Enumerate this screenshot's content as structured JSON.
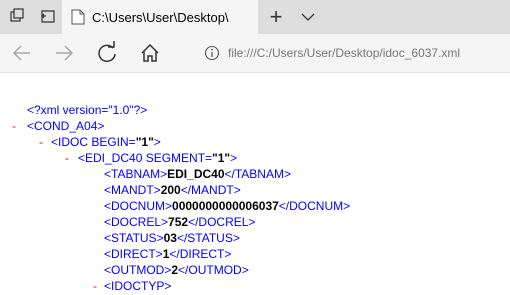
{
  "tab": {
    "title": "C:\\Users\\User\\Desktop\\",
    "new_tab_symbol": "+"
  },
  "address": {
    "url": "file:///C:/Users/User/Desktop/idoc_6037.xml"
  },
  "icons": [
    "tab-preview-icon",
    "tab-aside-icon",
    "page-icon",
    "chevron-down-icon",
    "back-icon",
    "forward-icon",
    "refresh-icon",
    "home-icon",
    "info-icon"
  ],
  "xml": {
    "decl": "<?xml version=\"1.0\"?>",
    "minus": "-",
    "cond_open": "<COND_A04>",
    "idoc_tag": "<IDOC BEGIN=",
    "idoc_val": "\"1\"",
    "idoc_end": ">",
    "edi_tag": "<EDI_DC40 SEGMENT=",
    "edi_val": "\"1\"",
    "edi_end": ">",
    "fields": [
      {
        "open": "<TABNAM>",
        "value": "EDI_DC40",
        "close": "</TABNAM>"
      },
      {
        "open": "<MANDT>",
        "value": "200",
        "close": "</MANDT>"
      },
      {
        "open": "<DOCNUM>",
        "value": "0000000000006037",
        "close": "</DOCNUM>"
      },
      {
        "open": "<DOCREL>",
        "value": "752",
        "close": "</DOCREL>"
      },
      {
        "open": "<STATUS>",
        "value": "03",
        "close": "</STATUS>"
      },
      {
        "open": "<DIRECT>",
        "value": "1",
        "close": "</DIRECT>"
      },
      {
        "open": "<OUTMOD>",
        "value": "2",
        "close": "</OUTMOD>"
      }
    ],
    "idoctyp": "<IDOCTYP>"
  }
}
